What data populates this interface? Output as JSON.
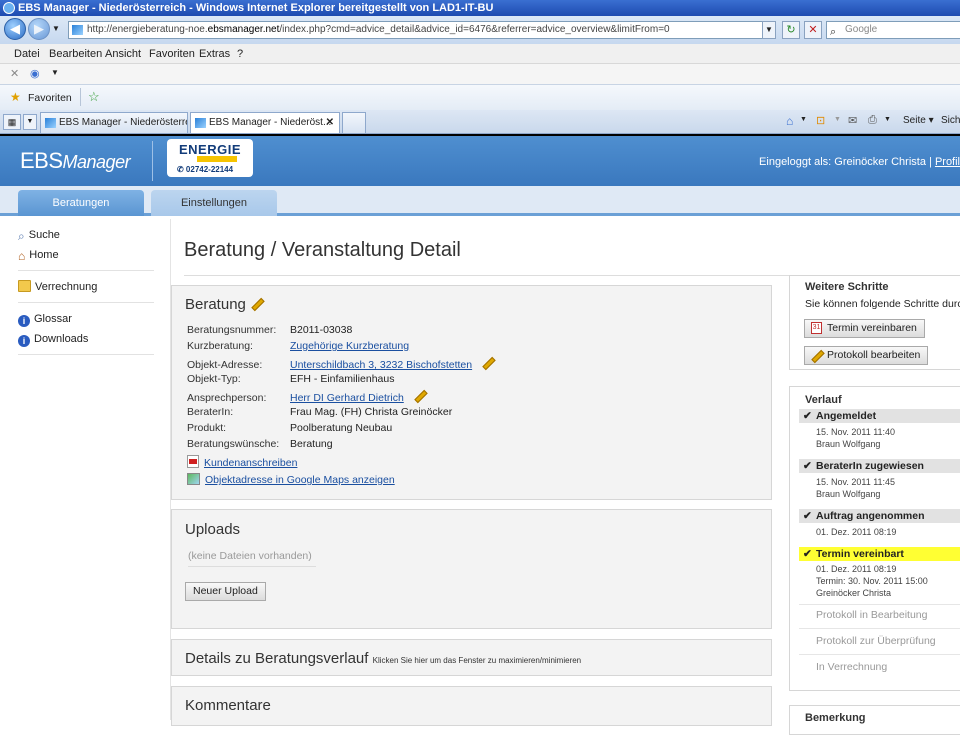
{
  "window": {
    "title": "EBS Manager - Niederösterreich - Windows Internet Explorer bereitgestellt von LAD1-IT-BU"
  },
  "address": {
    "url_prefix": "http://energieberatung-noe.",
    "url_host": "ebsmanager.net",
    "url_rest": "/index.php?cmd=advice_detail&advice_id=6476&referrer=advice_overview&limitFrom=0",
    "search_placeholder": "Google"
  },
  "menu": [
    "Datei",
    "Bearbeiten",
    "Ansicht",
    "Favoriten",
    "Extras",
    "?"
  ],
  "favorites": {
    "label": "Favoriten"
  },
  "browser_tabs": [
    "EBS Manager - Niederösterre...",
    "EBS Manager - Niederöst..."
  ],
  "browser_tools": {
    "seite": "Seite ▾",
    "sicherheit": "Sich"
  },
  "app": {
    "logo_ebs": "EBS",
    "logo_manager": "Manager",
    "energie_logo_text": "ENERGIE",
    "energie_phone": "✆ 02742-22144",
    "logged_in": "Eingeloggt als: Greinöcker Christa | ",
    "profile_link": "Profil",
    "tabs": [
      "Beratungen",
      "Einstellungen"
    ]
  },
  "sidebar": {
    "items": [
      {
        "label": "Suche",
        "icon": "magnifier-icon"
      },
      {
        "label": "Home",
        "icon": "house-icon"
      },
      {
        "label": "Verrechnung",
        "icon": "folder-icon"
      },
      {
        "label": "Glossar",
        "icon": "info-icon"
      },
      {
        "label": "Downloads",
        "icon": "info-icon"
      }
    ]
  },
  "page": {
    "title": "Beratung / Veranstaltung Detail",
    "beratung": {
      "heading": "Beratung",
      "fields": [
        {
          "label": "Beratungsnummer:",
          "value": "B2011-03038",
          "link": false
        },
        {
          "label": "Kurzberatung:",
          "value": "Zugehörige Kurzberatung",
          "link": true
        },
        {
          "label": "Objekt-Adresse:",
          "value": "Unterschildbach 3, 3232 Bischofstetten",
          "link": true
        },
        {
          "label": "Objekt-Typ:",
          "value": "EFH - Einfamilienhaus",
          "link": false
        },
        {
          "label": "Ansprechperson:",
          "value": "Herr DI Gerhard Dietrich",
          "link": true
        },
        {
          "label": "BeraterIn:",
          "value": "Frau Mag. (FH) Christa Greinöcker",
          "link": false
        },
        {
          "label": "Produkt:",
          "value": "Poolberatung Neubau",
          "link": false
        },
        {
          "label": "Beratungswünsche:",
          "value": "Beratung",
          "link": false
        }
      ],
      "kundenanschreiben": "Kundenanschreiben",
      "maps_link": "Objektadresse in Google Maps anzeigen"
    },
    "uploads": {
      "heading": "Uploads",
      "empty": "(keine Dateien vorhanden)",
      "button": "Neuer Upload"
    },
    "details": {
      "heading": "Details zu Beratungsverlauf",
      "hint": "Klicken Sie hier um das Fenster zu maximieren/minimieren"
    },
    "kommentare": {
      "heading": "Kommentare"
    }
  },
  "weitere_schritte": {
    "title": "Weitere Schritte",
    "desc": "Sie können folgende Schritte durc",
    "btn_termin": "Termin vereinbaren",
    "btn_protokoll": "Protokoll bearbeiten"
  },
  "verlauf": {
    "title": "Verlauf",
    "steps": [
      {
        "label": "Angemeldet",
        "lines": [
          "15. Nov. 2011 11:40",
          "Braun Wolfgang"
        ]
      },
      {
        "label": "BeraterIn zugewiesen",
        "lines": [
          "15. Nov. 2011 11:45",
          "Braun Wolfgang"
        ]
      },
      {
        "label": "Auftrag angenommen",
        "lines": [
          "01. Dez. 2011 08:19"
        ]
      },
      {
        "label": "Termin vereinbart",
        "lines": [
          "01. Dez. 2011 08:19",
          "Termin: 30. Nov. 2011 15:00",
          "Greinöcker Christa"
        ]
      }
    ],
    "pending": [
      "Protokoll in Bearbeitung",
      "Protokoll zur Überprüfung",
      "In Verrechnung"
    ]
  },
  "bemerkung": {
    "title": "Bemerkung"
  },
  "colors": {
    "header_blue": "#3a78be",
    "highlight": "#ffff33",
    "link": "#1a4fa0"
  }
}
